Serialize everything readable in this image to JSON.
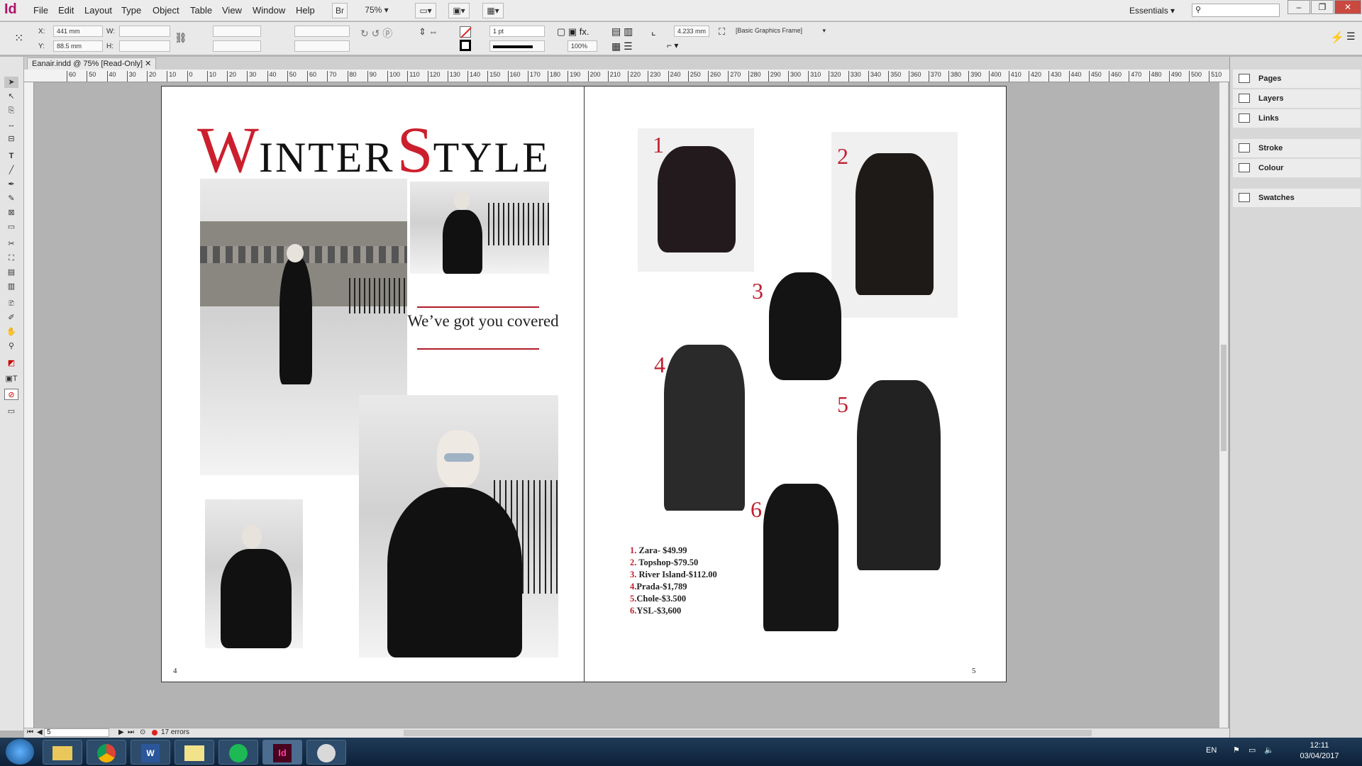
{
  "app": {
    "logo": "Id",
    "menu": [
      "File",
      "Edit",
      "Layout",
      "Type",
      "Object",
      "Table",
      "View",
      "Window",
      "Help"
    ],
    "br_label": "Br",
    "zoom": "75%",
    "workspace": "Essentials"
  },
  "control": {
    "x_label": "X:",
    "x_value": "441 mm",
    "y_label": "Y:",
    "y_value": "88.5 mm",
    "w_label": "W:",
    "h_label": "H:",
    "stroke_weight": "1 pt",
    "opacity": "100%",
    "offset": "4.233 mm",
    "frame_style": "[Basic Graphics Frame]"
  },
  "document": {
    "tab_title": "Eanair.indd @ 75% [Read-Only]",
    "ruler_labels": [
      "60",
      "50",
      "40",
      "30",
      "20",
      "10",
      "0",
      "10",
      "20",
      "30",
      "40",
      "50",
      "60",
      "70",
      "80",
      "90",
      "100",
      "110",
      "120",
      "130",
      "140",
      "150",
      "160",
      "170",
      "180",
      "190",
      "200",
      "210",
      "220",
      "230",
      "240",
      "250",
      "260",
      "270",
      "280",
      "290",
      "300",
      "310",
      "320",
      "330",
      "340",
      "350",
      "360",
      "370",
      "380",
      "390",
      "400",
      "410",
      "420",
      "430",
      "440",
      "450",
      "460",
      "470",
      "480",
      "490",
      "500",
      "510"
    ]
  },
  "left_page": {
    "title_w": "W",
    "title_inter": "INTER",
    "title_s": "S",
    "title_tyle": "TYLE",
    "tagline": "We’ve got you covered",
    "page_number": "4"
  },
  "right_page": {
    "item_numbers": [
      "1",
      "2",
      "3",
      "4",
      "5",
      "6"
    ],
    "prices": [
      {
        "n": "1.",
        "text": " Zara- $49.99"
      },
      {
        "n": "2.",
        "text": " Topshop-$79.50"
      },
      {
        "n": "3.",
        "text": " River Island-$112.00"
      },
      {
        "n": "4.",
        "text": "Prada-$1,789"
      },
      {
        "n": "5.",
        "text": "Chole-$3.500"
      },
      {
        "n": "6.",
        "text": "YSL-$3,600"
      }
    ],
    "page_number": "5"
  },
  "panels": [
    "Pages",
    "Layers",
    "Links",
    "Stroke",
    "Colour",
    "Swatches"
  ],
  "status": {
    "page_field": "5",
    "errors": "17 errors"
  },
  "taskbar": {
    "lang": "EN",
    "time": "12:11",
    "date": "03/04/2017"
  },
  "colors": {
    "accent_red": "#cc1f2d",
    "indesign_pink": "#b0146b"
  }
}
